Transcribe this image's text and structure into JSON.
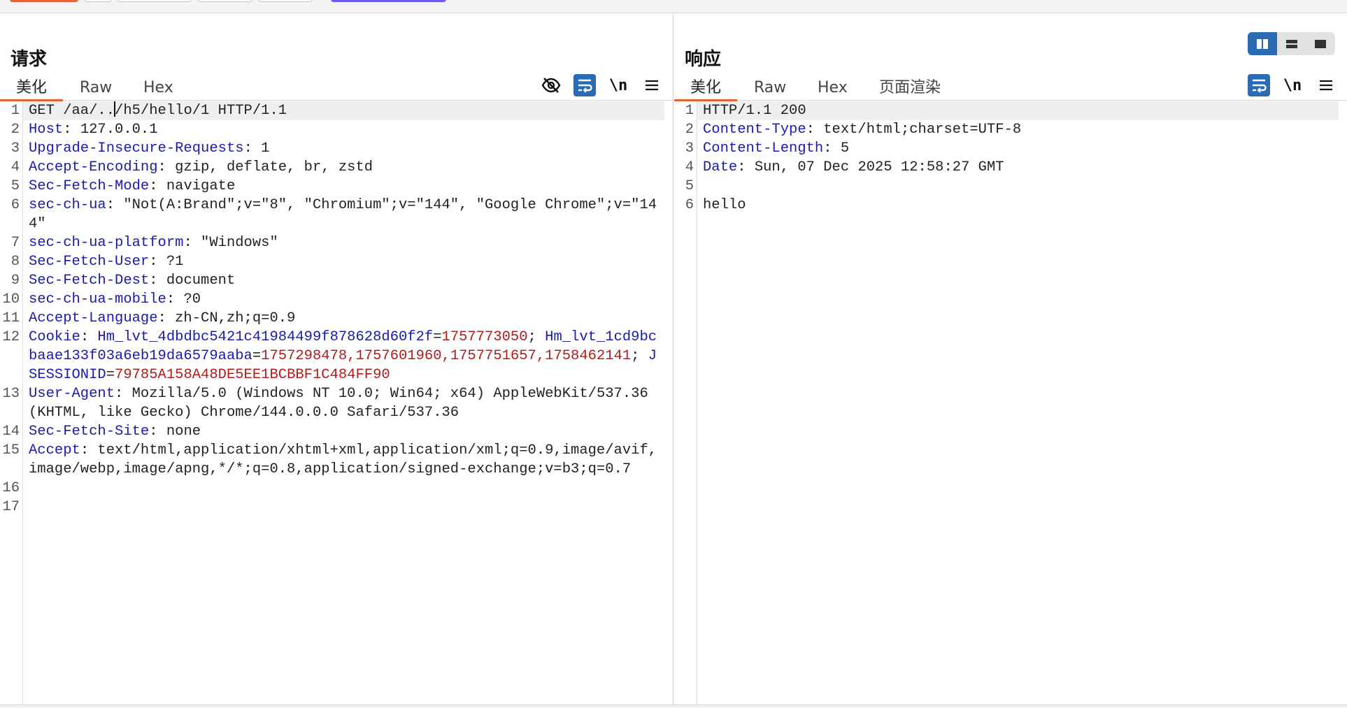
{
  "request_panel": {
    "title": "请求",
    "tabs": [
      "美化",
      "Raw",
      "Hex"
    ],
    "active_tab": "美化",
    "tool_icons": {
      "hide": "eye-slash-icon",
      "wrap": "word-wrap-icon",
      "newline_label": "\\n",
      "menu": "hamburger-menu-icon"
    },
    "lines": [
      {
        "n": "1",
        "segments": [
          {
            "t": "GET /aa/..",
            "c": "v"
          },
          {
            "t": "",
            "c": "caret"
          },
          {
            "t": "/h5/hello/1 HTTP/1.1",
            "c": "v"
          }
        ]
      },
      {
        "n": "2",
        "segments": [
          {
            "t": "Host",
            "c": "k"
          },
          {
            "t": ": 127.0.0.1",
            "c": "v"
          }
        ]
      },
      {
        "n": "3",
        "segments": [
          {
            "t": "Upgrade-Insecure-Requests",
            "c": "k"
          },
          {
            "t": ": 1",
            "c": "v"
          }
        ]
      },
      {
        "n": "4",
        "segments": [
          {
            "t": "Accept-Encoding",
            "c": "k"
          },
          {
            "t": ": gzip, deflate, br, zstd",
            "c": "v"
          }
        ]
      },
      {
        "n": "5",
        "segments": [
          {
            "t": "Sec-Fetch-Mode",
            "c": "k"
          },
          {
            "t": ": navigate",
            "c": "v"
          }
        ]
      },
      {
        "n": "6",
        "segments": [
          {
            "t": "sec-ch-ua",
            "c": "k"
          },
          {
            "t": ": \"Not(A:Brand\";v=\"8\", \"Chromium\";v=\"144\", \"Google Chrome\";v=\"144\"",
            "c": "v"
          }
        ]
      },
      {
        "n": "7",
        "segments": [
          {
            "t": "sec-ch-ua-platform",
            "c": "k"
          },
          {
            "t": ": \"Windows\"",
            "c": "v"
          }
        ]
      },
      {
        "n": "8",
        "segments": [
          {
            "t": "Sec-Fetch-User",
            "c": "k"
          },
          {
            "t": ": ?1",
            "c": "v"
          }
        ]
      },
      {
        "n": "9",
        "segments": [
          {
            "t": "Sec-Fetch-Dest",
            "c": "k"
          },
          {
            "t": ": document",
            "c": "v"
          }
        ]
      },
      {
        "n": "10",
        "segments": [
          {
            "t": "sec-ch-ua-mobile",
            "c": "k"
          },
          {
            "t": ": ?0",
            "c": "v"
          }
        ]
      },
      {
        "n": "11",
        "segments": [
          {
            "t": "Accept-Language",
            "c": "k"
          },
          {
            "t": ": zh-CN,zh;q=0.9",
            "c": "v"
          }
        ]
      },
      {
        "n": "12",
        "segments": [
          {
            "t": "Cookie",
            "c": "k"
          },
          {
            "t": ": ",
            "c": "v"
          },
          {
            "t": "Hm_lvt_4dbdbc5421c41984499f878628d60f2f",
            "c": "ck"
          },
          {
            "t": "=",
            "c": "v"
          },
          {
            "t": "1757773050",
            "c": "cv"
          },
          {
            "t": "; ",
            "c": "v"
          },
          {
            "t": "Hm_lvt_1cd9bcbaae133f03a6eb19da6579aaba",
            "c": "ck"
          },
          {
            "t": "=",
            "c": "v"
          },
          {
            "t": "1757298478,1757601960,1757751657,1758462141",
            "c": "cv"
          },
          {
            "t": "; ",
            "c": "v"
          },
          {
            "t": "JSESSIONID",
            "c": "ck"
          },
          {
            "t": "=",
            "c": "v"
          },
          {
            "t": "79785A158A48DE5EE1BCBBF1C484FF90",
            "c": "cv"
          }
        ]
      },
      {
        "n": "13",
        "segments": [
          {
            "t": "User-Agent",
            "c": "k"
          },
          {
            "t": ": Mozilla/5.0 (Windows NT 10.0; Win64; x64) AppleWebKit/537.36 (KHTML, like Gecko) Chrome/144.0.0.0 Safari/537.36",
            "c": "v"
          }
        ]
      },
      {
        "n": "14",
        "segments": [
          {
            "t": "Sec-Fetch-Site",
            "c": "k"
          },
          {
            "t": ": none",
            "c": "v"
          }
        ]
      },
      {
        "n": "15",
        "segments": [
          {
            "t": "Accept",
            "c": "k"
          },
          {
            "t": ": text/html,application/xhtml+xml,application/xml;q=0.9,image/avif,image/webp,image/apng,*/*;q=0.8,application/signed-exchange;v=b3;q=0.7",
            "c": "v"
          }
        ]
      },
      {
        "n": "16",
        "segments": []
      },
      {
        "n": "17",
        "segments": []
      }
    ]
  },
  "response_panel": {
    "title": "响应",
    "tabs": [
      "美化",
      "Raw",
      "Hex",
      "页面渲染"
    ],
    "active_tab": "美化",
    "tool_icons": {
      "wrap": "word-wrap-icon",
      "newline_label": "\\n",
      "menu": "hamburger-menu-icon"
    },
    "layout_toggle": [
      "split-vertical-icon",
      "split-horizontal-icon",
      "single-pane-icon"
    ],
    "lines": [
      {
        "n": "1",
        "segments": [
          {
            "t": "HTTP/1.1 200",
            "c": "v"
          }
        ]
      },
      {
        "n": "2",
        "segments": [
          {
            "t": "Content-Type",
            "c": "k"
          },
          {
            "t": ": text/html;charset=UTF-8",
            "c": "v"
          }
        ]
      },
      {
        "n": "3",
        "segments": [
          {
            "t": "Content-Length",
            "c": "k"
          },
          {
            "t": ": 5",
            "c": "v"
          }
        ]
      },
      {
        "n": "4",
        "segments": [
          {
            "t": "Date",
            "c": "k"
          },
          {
            "t": ": Sun, 07 Dec 2025 12:58:27 GMT",
            "c": "v"
          }
        ]
      },
      {
        "n": "5",
        "segments": []
      },
      {
        "n": "6",
        "segments": [
          {
            "t": "hello",
            "c": "v"
          }
        ]
      }
    ]
  },
  "colors": {
    "accent_tab": "#e8603a",
    "active_icon_bg": "#2a6bb3",
    "header_key": "#1a1ab3",
    "cookie_value": "#b31b1b"
  }
}
